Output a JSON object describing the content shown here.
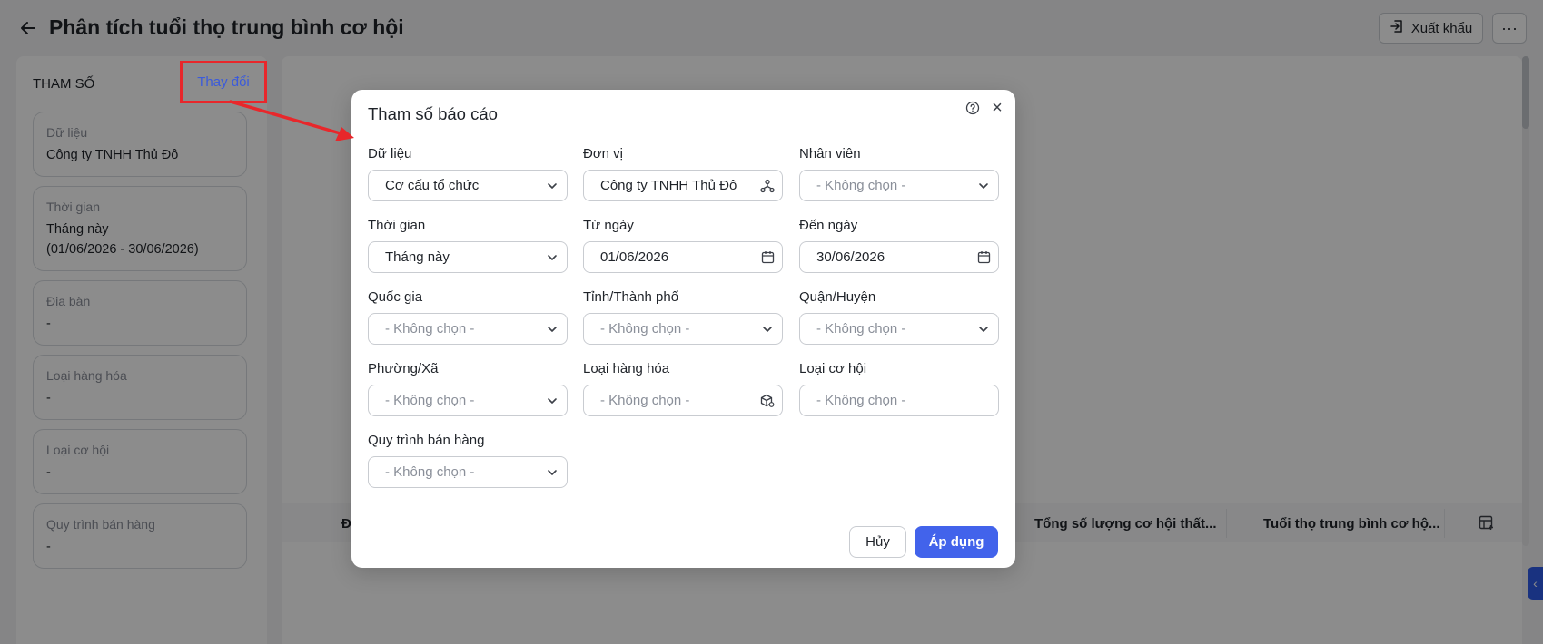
{
  "header": {
    "title": "Phân tích tuổi thọ trung bình cơ hội",
    "export_label": "Xuất khẩu",
    "more_label": "···"
  },
  "left_panel": {
    "title": "THAM SỐ",
    "change_label": "Thay đổi",
    "cards": [
      {
        "label": "Dữ liệu",
        "value": "Công ty TNHH Thủ Đô"
      },
      {
        "label": "Thời gian",
        "value": "Tháng này",
        "value2": "(01/06/2026 - 30/06/2026)"
      },
      {
        "label": "Địa bàn",
        "value": "-"
      },
      {
        "label": "Loại hàng hóa",
        "value": "-"
      },
      {
        "label": "Loại cơ hội",
        "value": "-"
      },
      {
        "label": "Quy trình bán hàng",
        "value": "-"
      }
    ]
  },
  "table": {
    "col_first_initial": "Đ",
    "col_lost_total": "Tổng số lượng cơ hội thất...",
    "col_avg_age": "Tuổi thọ trung bình cơ hộ..."
  },
  "modal": {
    "title": "Tham số báo cáo",
    "fields": {
      "du_lieu": {
        "label": "Dữ liệu",
        "value": "Cơ cấu tổ chức"
      },
      "don_vi": {
        "label": "Đơn vị",
        "value": "Công ty TNHH Thủ Đô"
      },
      "nhan_vien": {
        "label": "Nhân viên",
        "placeholder": "- Không chọn -"
      },
      "thoi_gian": {
        "label": "Thời gian",
        "value": "Tháng này"
      },
      "tu_ngay": {
        "label": "Từ ngày",
        "value": "01/06/2026"
      },
      "den_ngay": {
        "label": "Đến ngày",
        "value": "30/06/2026"
      },
      "quoc_gia": {
        "label": "Quốc gia",
        "placeholder": "- Không chọn -"
      },
      "tinh_thanh": {
        "label": "Tỉnh/Thành phố",
        "placeholder": "- Không chọn -"
      },
      "quan_huyen": {
        "label": "Quận/Huyện",
        "placeholder": "- Không chọn -"
      },
      "phuong_xa": {
        "label": "Phường/Xã",
        "placeholder": "- Không chọn -"
      },
      "loai_hang_hoa": {
        "label": "Loại hàng hóa",
        "placeholder": "- Không chọn -"
      },
      "loai_co_hoi": {
        "label": "Loại cơ hội",
        "placeholder": "- Không chọn -"
      },
      "quy_trinh": {
        "label": "Quy trình bán hàng",
        "placeholder": "- Không chọn -"
      }
    },
    "cancel_label": "Hủy",
    "apply_label": "Áp dụng"
  },
  "colors": {
    "accent": "#4263eb",
    "annotation": "#e8272b",
    "link": "#3b5bdb"
  },
  "icons": [
    "back-arrow-icon",
    "export-icon",
    "more-icon",
    "help-icon",
    "close-icon",
    "chevron-down-icon",
    "org-tree-icon",
    "calendar-icon",
    "product-icon",
    "column-settings-icon",
    "chevron-left-icon"
  ]
}
